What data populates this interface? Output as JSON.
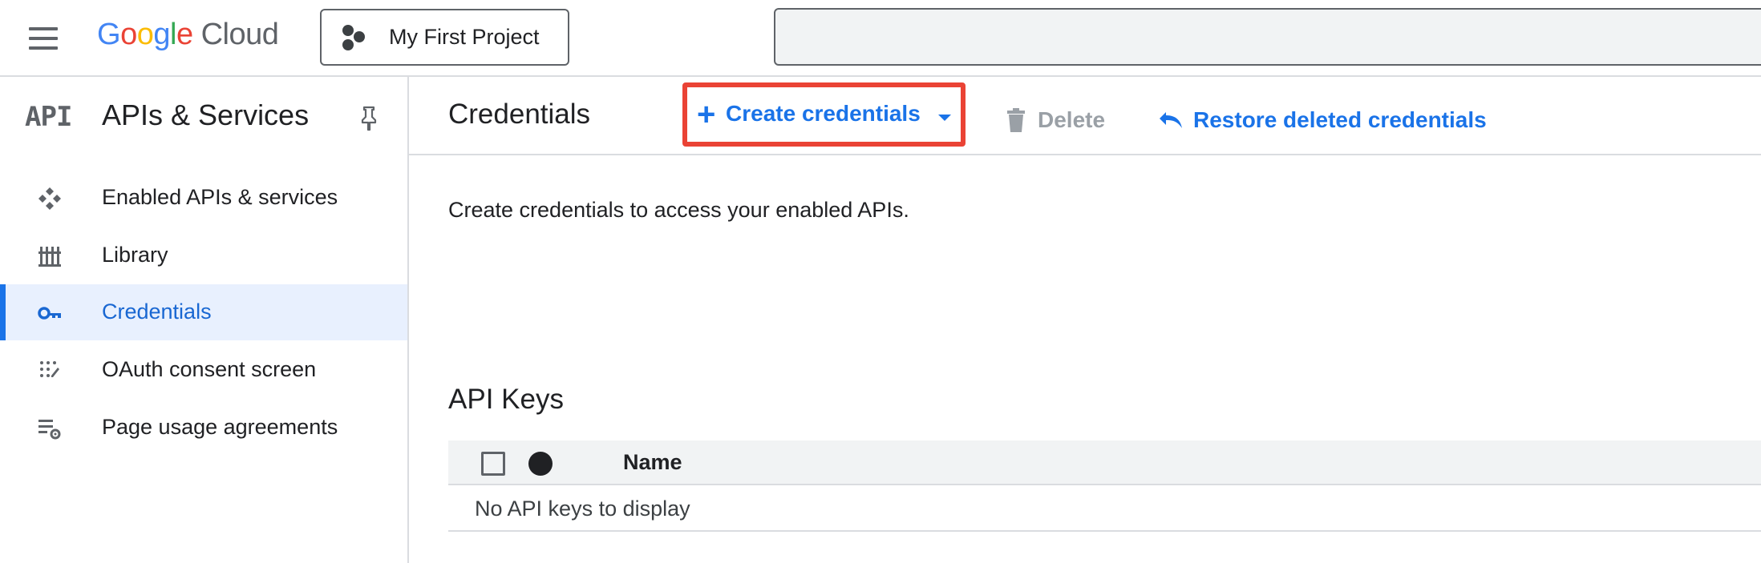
{
  "header": {
    "logo_google": "Google",
    "logo_cloud": "Cloud",
    "project_label": "My First Project",
    "search_placeholder": ""
  },
  "sidebar": {
    "api_logo": "API",
    "title": "APIs & Services",
    "items": [
      {
        "label": "Enabled APIs & services",
        "icon": "apis-diamond-icon",
        "active": false
      },
      {
        "label": "Library",
        "icon": "library-icon",
        "active": false
      },
      {
        "label": "Credentials",
        "icon": "key-icon",
        "active": true
      },
      {
        "label": "OAuth consent screen",
        "icon": "oauth-dots-icon",
        "active": false
      },
      {
        "label": "Page usage agreements",
        "icon": "settings-list-icon",
        "active": false
      }
    ]
  },
  "toolbar": {
    "title": "Credentials",
    "create_label": "Create credentials",
    "delete_label": "Delete",
    "restore_label": "Restore deleted credentials"
  },
  "content": {
    "description": "Create credentials to access your enabled APIs.",
    "api_keys_title": "API Keys",
    "table": {
      "columns": [
        "Name"
      ],
      "empty_message": "No API keys to display"
    }
  },
  "colors": {
    "accent": "#1a73e8",
    "highlight_border": "#ea4335",
    "active_bg": "#e8f0fe"
  }
}
